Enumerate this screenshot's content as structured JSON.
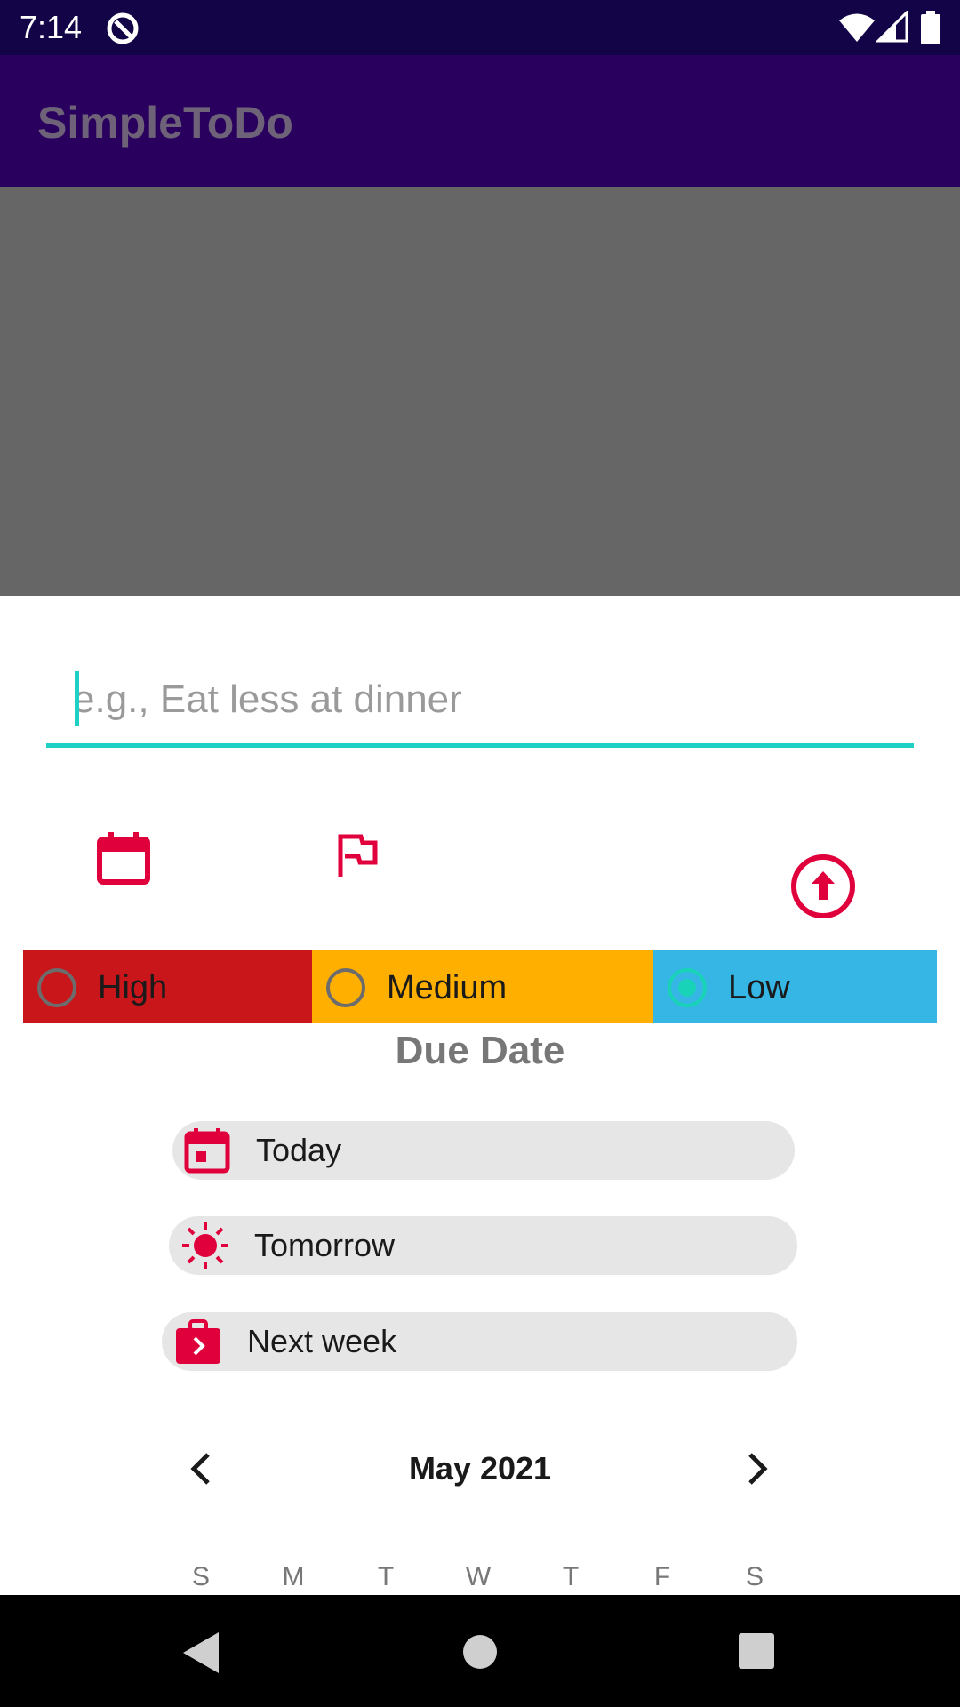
{
  "status_bar": {
    "time": "7:14"
  },
  "app_bar": {
    "title": "SimpleToDo"
  },
  "task_input": {
    "placeholder": "e.g., Eat less at dinner",
    "value": ""
  },
  "priority": {
    "options": [
      {
        "label": "High",
        "color": "#c8161a",
        "selected": false
      },
      {
        "label": "Medium",
        "color": "#ffaf00",
        "selected": false
      },
      {
        "label": "Low",
        "color": "#35b6e5",
        "selected": true
      }
    ]
  },
  "due_date": {
    "heading": "Due Date",
    "quick_options": [
      {
        "label": "Today",
        "icon": "calendar-today-icon"
      },
      {
        "label": "Tomorrow",
        "icon": "sun-icon"
      },
      {
        "label": "Next week",
        "icon": "briefcase-arrow-icon"
      }
    ]
  },
  "calendar": {
    "month_label": "May 2021",
    "weekdays": [
      "S",
      "M",
      "T",
      "W",
      "T",
      "F",
      "S"
    ]
  },
  "colors": {
    "accent": "#1fd1c4",
    "icon_red": "#e0003c",
    "app_bar": "#2a005e"
  }
}
